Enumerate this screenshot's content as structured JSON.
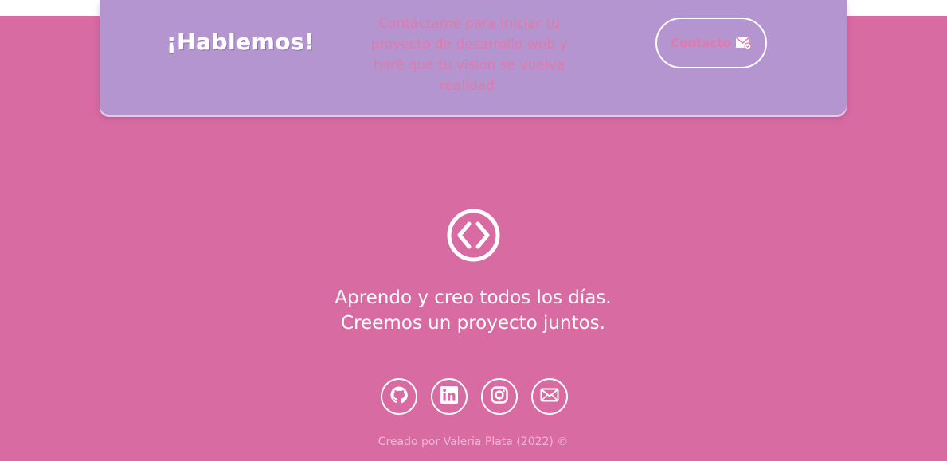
{
  "cta": {
    "title": "¡Hablemos!",
    "text": "Contáctame para iniciar tu proyecto de desarrollo web y haré que tu visión se vuelva realidad.",
    "button_label": "Contacto",
    "button_icon": "mail-send-icon"
  },
  "footer": {
    "logo_icon": "code-brackets-icon",
    "tagline_line1": "Aprendo y creo todos los días.",
    "tagline_line2": "Creemos un proyecto juntos.",
    "socials": [
      {
        "name": "github",
        "icon": "github-icon"
      },
      {
        "name": "linkedin",
        "icon": "linkedin-icon"
      },
      {
        "name": "instagram",
        "icon": "instagram-icon"
      },
      {
        "name": "email",
        "icon": "email-icon"
      }
    ],
    "copyright": "Creado por Valeria Plata (2022) ©"
  },
  "colors": {
    "background": "#d96ba3",
    "card": "#b595cf",
    "accent_text": "#e07aab",
    "white": "#ffffff"
  }
}
